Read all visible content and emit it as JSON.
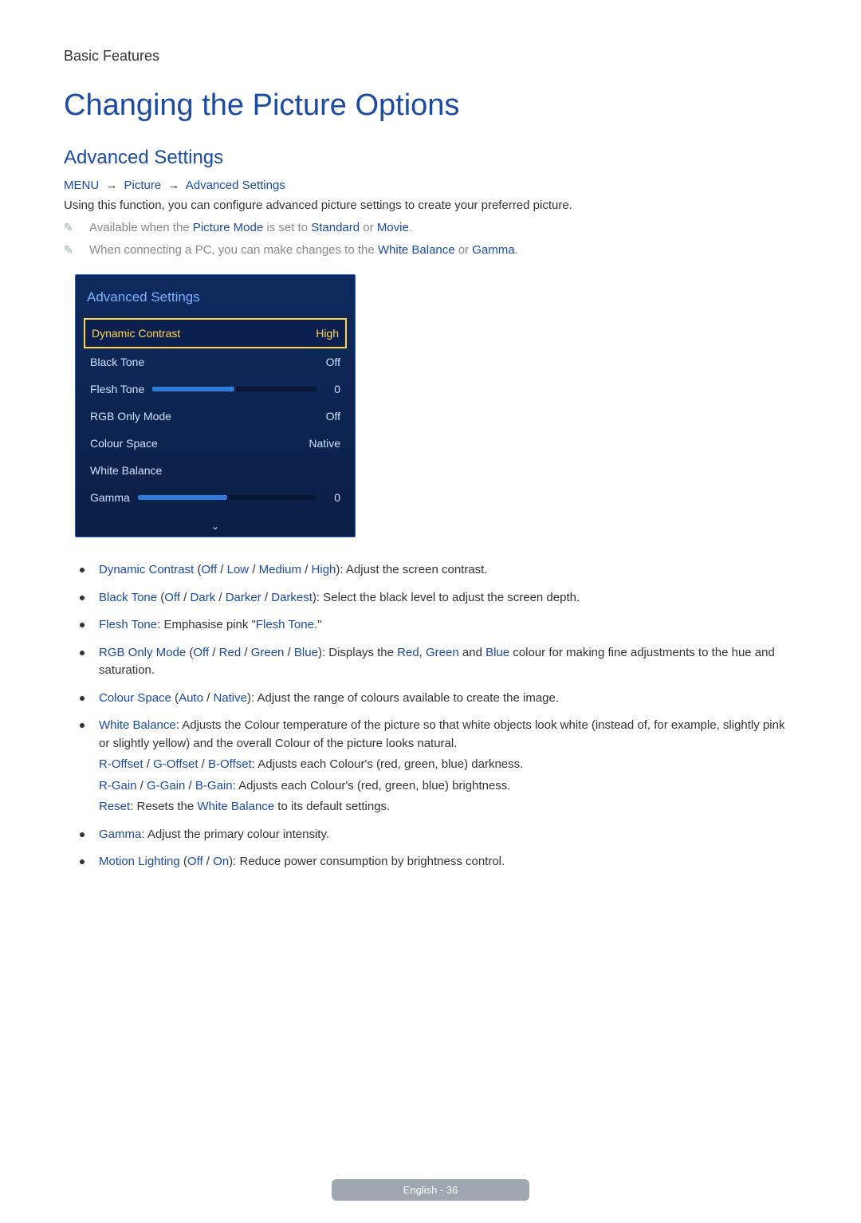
{
  "header": {
    "label": "Basic Features"
  },
  "title": "Changing the Picture Options",
  "section": "Advanced Settings",
  "breadcrumb": {
    "menu": "MENU",
    "picture": "Picture",
    "adv": "Advanced Settings"
  },
  "intro": "Using this function, you can configure advanced picture settings to create your preferred picture.",
  "notes": {
    "n1_pre": "Available when the ",
    "n1_k1": "Picture Mode",
    "n1_mid": " is set to ",
    "n1_k2": "Standard",
    "n1_or": " or ",
    "n1_k3": "Movie",
    "n1_post": ".",
    "n2_pre": "When connecting a PC, you can make changes to the ",
    "n2_k1": "White Balance",
    "n2_or": " or ",
    "n2_k2": "Gamma",
    "n2_post": "."
  },
  "osd": {
    "title": "Advanced Settings",
    "rows": [
      {
        "label": "Dynamic Contrast",
        "value": "High",
        "selected": true
      },
      {
        "label": "Black Tone",
        "value": "Off"
      },
      {
        "label": "Flesh Tone",
        "value": "0",
        "slider": 50
      },
      {
        "label": "RGB Only Mode",
        "value": "Off"
      },
      {
        "label": "Colour Space",
        "value": "Native"
      },
      {
        "label": "White Balance",
        "value": ""
      },
      {
        "label": "Gamma",
        "value": "0",
        "slider": 50
      }
    ]
  },
  "bullets": {
    "b1": {
      "k": "Dynamic Contrast",
      "o1": "Off",
      "o2": "Low",
      "o3": "Medium",
      "o4": "High",
      "desc": "): Adjust the screen contrast."
    },
    "b2": {
      "k": "Black Tone",
      "o1": "Off",
      "o2": "Dark",
      "o3": "Darker",
      "o4": "Darkest",
      "desc": "): Select the black level to adjust the screen depth."
    },
    "b3": {
      "k": "Flesh Tone",
      "mid": ": Emphasise pink \"",
      "k2": "Flesh Tone",
      "post": ".\""
    },
    "b4": {
      "k": "RGB Only Mode",
      "o1": "Off",
      "o2": "Red",
      "o3": "Green",
      "o4": "Blue",
      "mid": "): Displays the ",
      "c1": "Red",
      "c2": "Green",
      "c3": "Blue",
      "and": " and ",
      "comma": ", ",
      "post": " colour for making fine adjustments to the hue and saturation."
    },
    "b5": {
      "k": "Colour Space",
      "o1": "Auto",
      "o2": "Native",
      "desc": "): Adjust the range of colours available to create the image."
    },
    "b6": {
      "k": "White Balance",
      "desc": ": Adjusts the Colour temperature of the picture so that white objects look white (instead of, for example, slightly pink or slightly yellow) and the overall Colour of the picture looks natural.",
      "l2a": "R-Offset",
      "l2b": "G-Offset",
      "l2c": "B-Offset",
      "l2desc": ": Adjusts each Colour's (red, green, blue) darkness.",
      "l3a": "R-Gain",
      "l3b": "G-Gain",
      "l3c": "B-Gain",
      "l3desc": ": Adjusts each Colour's (red, green, blue) brightness.",
      "l4a": "Reset",
      "l4mid": ": Resets the ",
      "l4b": "White Balance",
      "l4post": " to its default settings."
    },
    "b7": {
      "k": "Gamma",
      "desc": ": Adjust the primary colour intensity."
    },
    "b8": {
      "k": "Motion Lighting",
      "o1": "Off",
      "o2": "On",
      "desc": "): Reduce power consumption by brightness control."
    }
  },
  "footer": "English - 36",
  "slash": " / ",
  "open": " ("
}
